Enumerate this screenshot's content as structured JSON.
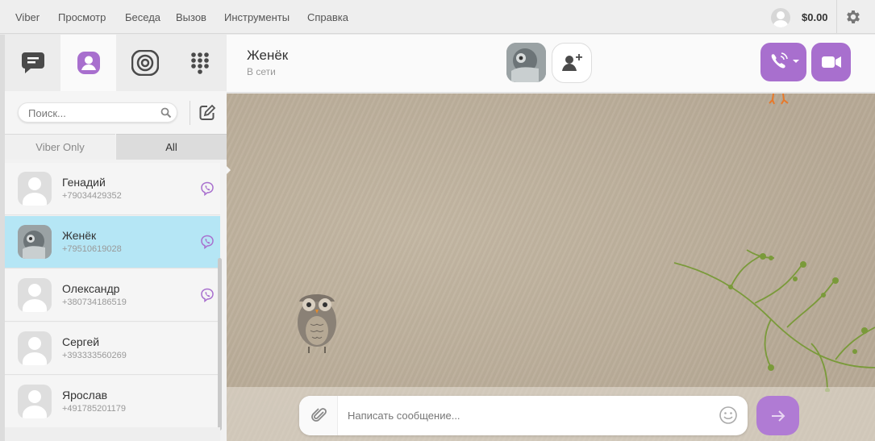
{
  "menu": {
    "items": [
      "Viber",
      "Просмотр",
      "Беседа",
      "Вызов",
      "Инструменты",
      "Справка"
    ],
    "balance": "$0.00"
  },
  "sidebar": {
    "search_placeholder": "Поиск...",
    "filter_tabs": [
      "Viber Only",
      "All"
    ],
    "active_filter": "All",
    "contacts": [
      {
        "name": "Генадий",
        "phone": "+79034429352",
        "viber": true,
        "selected": false,
        "photo": false
      },
      {
        "name": "Женёк",
        "phone": "+79510619028",
        "viber": true,
        "selected": true,
        "photo": true
      },
      {
        "name": "Олександр",
        "phone": "+380734186519",
        "viber": true,
        "selected": false,
        "photo": false
      },
      {
        "name": "Сергей",
        "phone": "+393333560269",
        "viber": false,
        "selected": false,
        "photo": false
      },
      {
        "name": "Ярослав",
        "phone": "+491785201179",
        "viber": false,
        "selected": false,
        "photo": false
      }
    ]
  },
  "chat": {
    "title": "Женёк",
    "status": "В сети",
    "message_placeholder": "Написать сообщение..."
  },
  "colors": {
    "accent": "#a86fce",
    "selected_row": "#b5e6f5"
  }
}
